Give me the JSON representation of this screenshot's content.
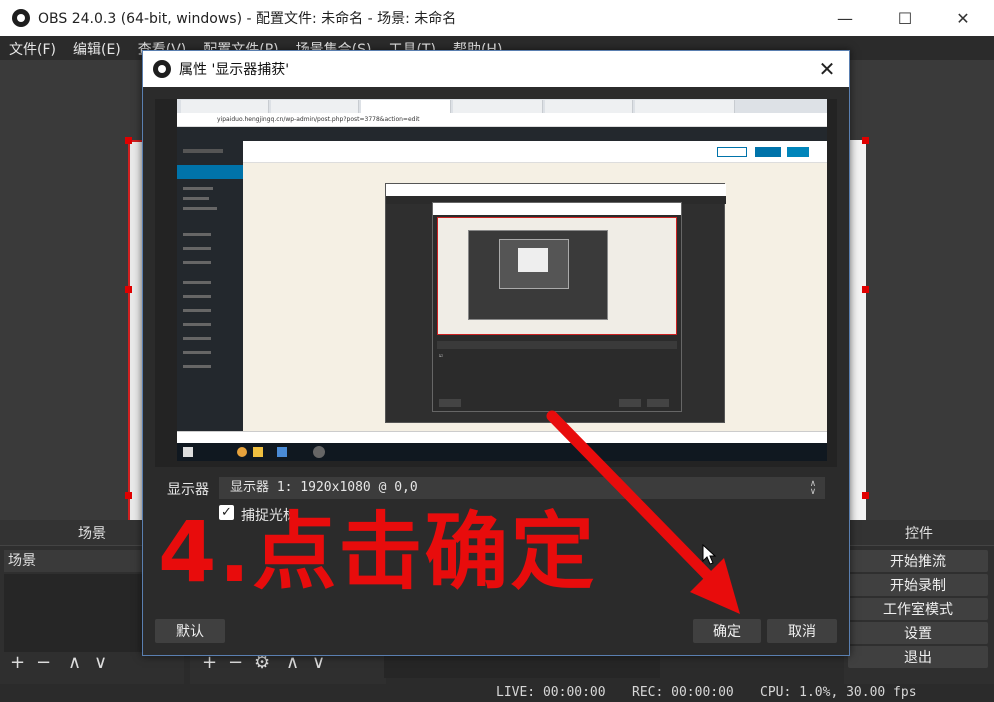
{
  "window": {
    "title": "OBS 24.0.3 (64-bit, windows) - 配置文件: 未命名 - 场景: 未命名",
    "minimize_icon": "—",
    "maximize_icon": "☐",
    "close_icon": "✕"
  },
  "menu": [
    "文件(F)",
    "编辑(E)",
    "查看(V)",
    "配置文件(P)",
    "场景集合(S)",
    "工具(T)",
    "帮助(H)"
  ],
  "dialog": {
    "title": "属性 '显示器捕获'",
    "close_icon": "✕",
    "display_label": "显示器",
    "display_value": "显示器 1: 1920x1080 @ 0,0",
    "capture_cursor_label": "捕捉光标",
    "capture_cursor_checked": true,
    "defaults_button": "默认",
    "ok_button": "确定",
    "cancel_button": "取消"
  },
  "nested_browser": {
    "address": "yipaiduo.hengjingq.cn/wp-admin/post.php?post=3778&action=edit"
  },
  "docks": {
    "scenes_title": "场景",
    "scene_list_header": "场景",
    "controls_title": "控件",
    "controls": [
      "开始推流",
      "开始录制",
      "工作室模式",
      "设置",
      "退出"
    ]
  },
  "toolbar_glyphs": {
    "add": "+",
    "remove": "−",
    "up": "∧",
    "down": "∨",
    "gear": "⚙"
  },
  "status": {
    "live": "LIVE: 00:00:00",
    "rec": "REC: 00:00:00",
    "cpu": "CPU: 1.0%, 30.00 fps"
  },
  "annotation": {
    "text": "4.点击确定",
    "color": "#e80c0c"
  }
}
